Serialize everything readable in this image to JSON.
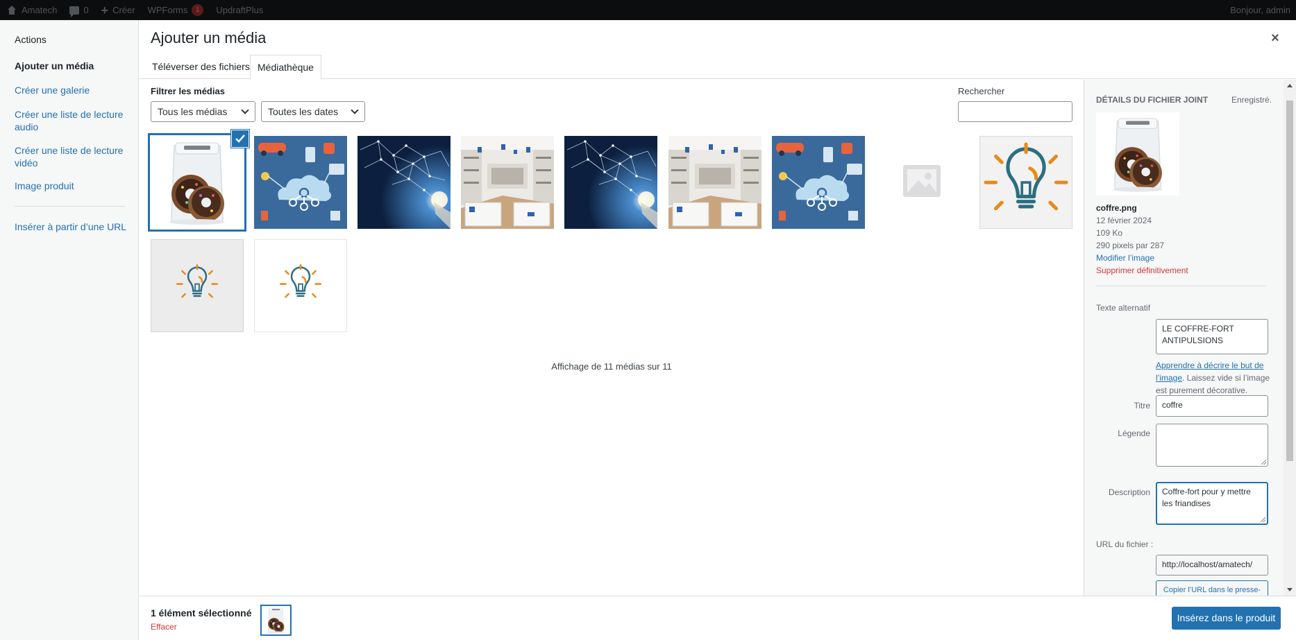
{
  "admin_bar": {
    "site_name": "Amatech",
    "comments_count": "0",
    "new_label": "Créer",
    "wpforms_label": "WPForms",
    "wpforms_badge": "1",
    "updraft_label": "UpdraftPlus",
    "greeting": "Bonjour, admin"
  },
  "menu": {
    "heading": "Actions",
    "items": [
      "Ajouter un média",
      "Créer une galerie",
      "Créer une liste de lecture audio",
      "Créer une liste de lecture vidéo",
      "Image produit",
      "Insérer à partir d’une URL"
    ]
  },
  "modal": {
    "title": "Ajouter un média",
    "close_symbol": "×",
    "tabs": [
      "Téléverser des fichiers",
      "Médiathèque"
    ]
  },
  "toolbar": {
    "filter_label": "Filtrer les médias",
    "type_filter": "Tous les médias",
    "date_filter": "Toutes les dates",
    "search_label": "Rechercher",
    "search_value": ""
  },
  "grid": {
    "items": [
      {
        "kind": "coffre",
        "selected": true
      },
      {
        "kind": "iot"
      },
      {
        "kind": "network"
      },
      {
        "kind": "store"
      },
      {
        "kind": "network"
      },
      {
        "kind": "store"
      },
      {
        "kind": "iot"
      },
      {
        "kind": "placeholder"
      },
      {
        "kind": "bulb-large"
      },
      {
        "kind": "bulb-small-grey"
      },
      {
        "kind": "bulb-small-white"
      }
    ],
    "status": "Affichage de 11 médias sur 11"
  },
  "details": {
    "heading": "Détails du fichier joint",
    "saved": "Enregistré.",
    "filename": "coffre.png",
    "date": "12 février 2024",
    "size": "109 Ko",
    "dimensions": "290 pixels par 287",
    "edit_link": "Modifier l’image",
    "delete_link": "Supprimer définitivement",
    "alt_label": "Texte alternatif",
    "alt_value": "LE COFFRE-FORT ANTIPULSIONS",
    "alt_help_link": "Apprendre à décrire le but de l’image",
    "alt_help_text": ". Laissez vide si l’image est purement décorative.",
    "title_label": "Titre",
    "title_value": "coffre",
    "caption_label": "Légende",
    "caption_value": "",
    "description_label": "Description",
    "description_value": "Coffre-fort pour  y mettre les friandises",
    "url_label": "URL du fichier :",
    "url_value": "http://localhost/amatech/",
    "copy_button": "Copier l’URL dans le presse-papiers"
  },
  "footer": {
    "selection_count": "1 élément sélectionné",
    "clear_link": "Effacer",
    "insert_button": "Insérez dans le produit"
  },
  "colors": {
    "accent": "#2271b1",
    "danger": "#d63638",
    "admin_bar": "#0c0d0e"
  }
}
